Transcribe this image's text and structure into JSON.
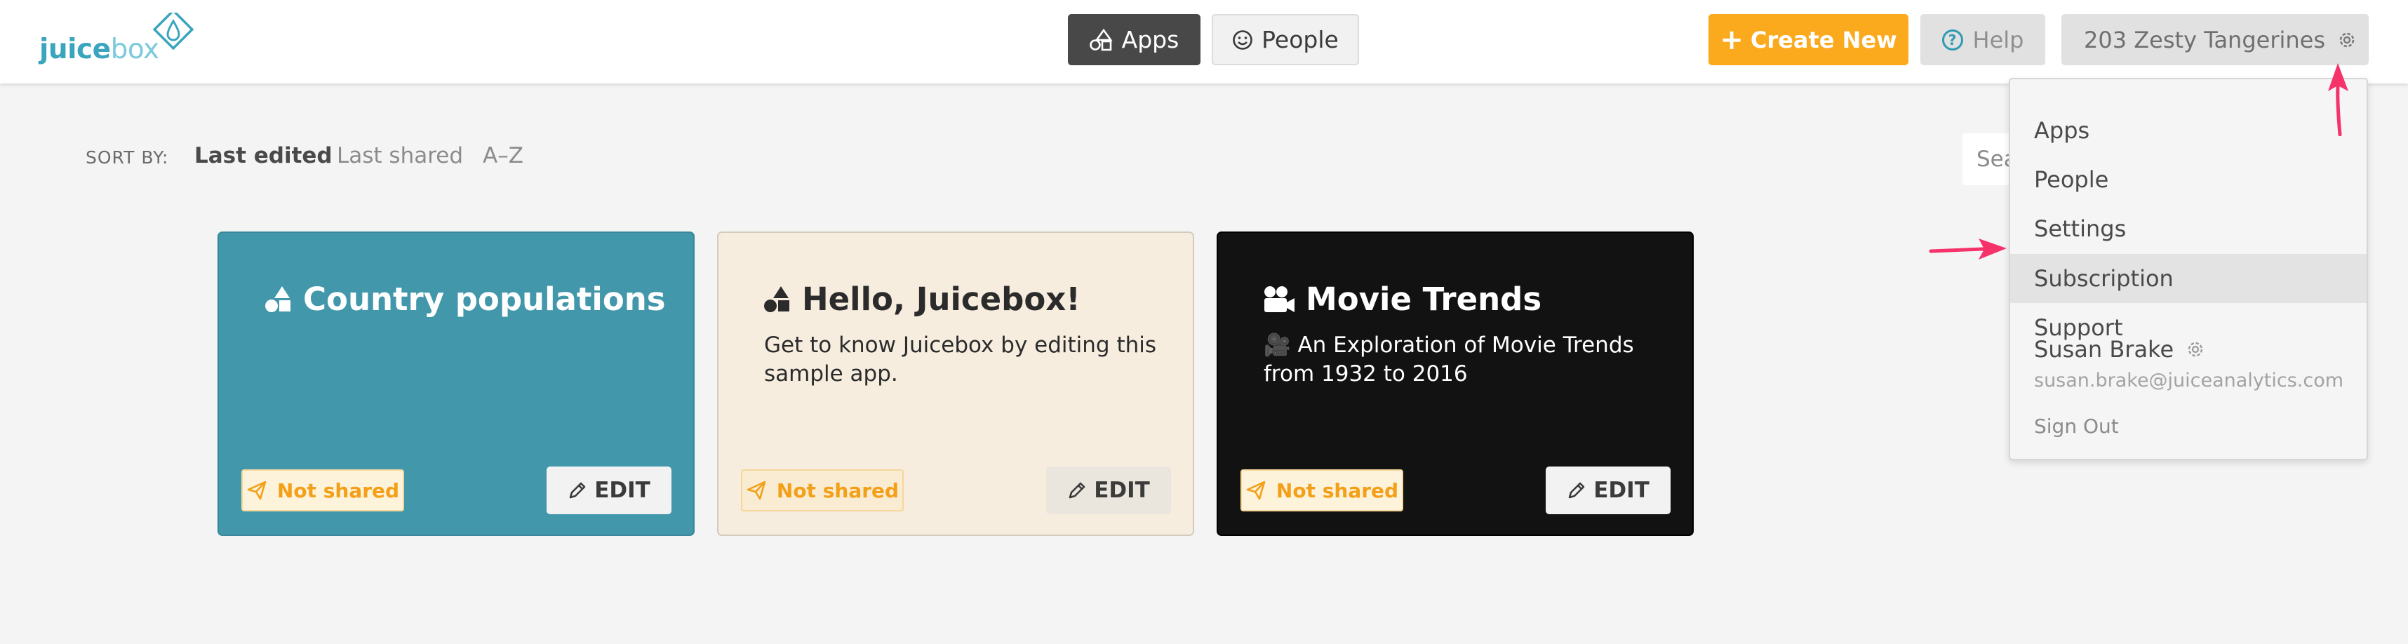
{
  "brand": {
    "logo_main": "juice",
    "logo_suffix": "box",
    "brand_color": "#3aa5bd",
    "accent_color": "#fbaa1e"
  },
  "header": {
    "nav": [
      {
        "label": "Apps",
        "icon": "apps-shapes-icon",
        "active": true
      },
      {
        "label": "People",
        "icon": "smiley-icon",
        "active": false
      }
    ],
    "create_label": "Create New",
    "help_label": "Help",
    "org_label": "203 Zesty Tangerines"
  },
  "sort": {
    "label": "SORT BY:",
    "options": [
      "Last edited",
      "Last shared",
      "A–Z"
    ],
    "active": "Last edited"
  },
  "search": {
    "placeholder": "Search"
  },
  "cards": [
    {
      "title": "Country populations",
      "description": "",
      "icon": "apps-shapes-icon",
      "badge": "Not shared",
      "edit_label": "EDIT",
      "background": "#4297ab"
    },
    {
      "title": "Hello, Juicebox!",
      "description": "Get to know Juicebox by editing this sample app.",
      "icon": "apps-shapes-icon",
      "badge": "Not shared",
      "edit_label": "EDIT",
      "background": "#f6eddf"
    },
    {
      "title": "Movie Trends",
      "description": "🎥 An Exploration of Movie Trends from 1932 to 2016",
      "icon": "film-camera-icon",
      "badge": "Not shared",
      "edit_label": "EDIT",
      "background": "#121212"
    }
  ],
  "dropdown": {
    "items": [
      "Apps",
      "People",
      "Settings",
      "Subscription",
      "Support"
    ],
    "highlighted": "Subscription",
    "user_name": "Susan Brake",
    "user_email": "susan.brake@juiceanalytics.com",
    "sign_out": "Sign Out"
  },
  "annotation_color": "#f5336a"
}
